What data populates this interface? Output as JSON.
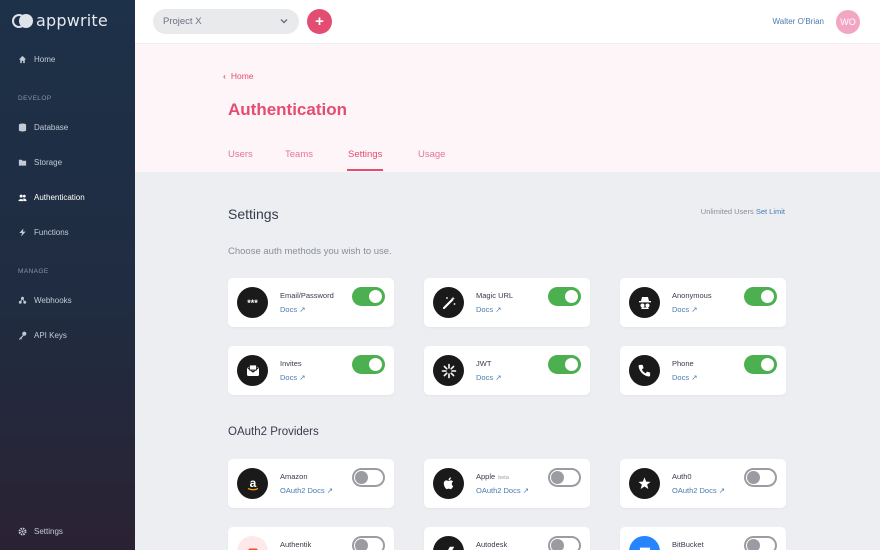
{
  "app": {
    "logo_text": "appwrite"
  },
  "sidebar": {
    "home": "Home",
    "develop_section": "DEVELOP",
    "items_develop": [
      {
        "label": "Database"
      },
      {
        "label": "Storage"
      },
      {
        "label": "Authentication"
      },
      {
        "label": "Functions"
      }
    ],
    "manage_section": "MANAGE",
    "items_manage": [
      {
        "label": "Webhooks"
      },
      {
        "label": "API Keys"
      }
    ],
    "settings": "Settings"
  },
  "topbar": {
    "project": "Project X",
    "add_label": "+",
    "user_name": "Walter O'Brian",
    "avatar_initials": "WO"
  },
  "header": {
    "breadcrumb": "Home",
    "title": "Authentication",
    "tabs": [
      "Users",
      "Teams",
      "Settings",
      "Usage"
    ],
    "active_tab": "Settings"
  },
  "settings": {
    "title": "Settings",
    "limit_prefix": "Unlimited Users",
    "limit_link": "Set Limit",
    "subtitle": "Choose auth methods you wish to use.",
    "methods": [
      {
        "name": "Email/Password",
        "docs": "Docs",
        "enabled": true,
        "icon": "asterisks-icon"
      },
      {
        "name": "Magic URL",
        "docs": "Docs",
        "enabled": true,
        "icon": "magic-wand-icon"
      },
      {
        "name": "Anonymous",
        "docs": "Docs",
        "enabled": true,
        "icon": "incognito-icon"
      },
      {
        "name": "Invites",
        "docs": "Docs",
        "enabled": true,
        "icon": "envelope-icon"
      },
      {
        "name": "JWT",
        "docs": "Docs",
        "enabled": true,
        "icon": "jwt-icon"
      },
      {
        "name": "Phone",
        "docs": "Docs",
        "enabled": true,
        "icon": "phone-icon"
      }
    ]
  },
  "oauth": {
    "title": "OAuth2 Providers",
    "providers": [
      {
        "name": "Amazon",
        "docs": "OAuth2 Docs",
        "enabled": false,
        "beta": "",
        "icon": "amazon-icon"
      },
      {
        "name": "Apple",
        "docs": "OAuth2 Docs",
        "enabled": false,
        "beta": "beta",
        "icon": "apple-icon"
      },
      {
        "name": "Auth0",
        "docs": "OAuth2 Docs",
        "enabled": false,
        "beta": "",
        "icon": "auth0-icon"
      },
      {
        "name": "Authentik",
        "docs": "",
        "enabled": false,
        "beta": "",
        "icon": "authentik-icon"
      },
      {
        "name": "Autodesk",
        "docs": "",
        "enabled": false,
        "beta": "",
        "icon": "autodesk-icon"
      },
      {
        "name": "BitBucket",
        "docs": "",
        "enabled": false,
        "beta": "",
        "icon": "bitbucket-icon"
      }
    ]
  },
  "colors": {
    "accent": "#e44d72",
    "toggle_on": "#4caf50",
    "link": "#4a7bb2"
  }
}
